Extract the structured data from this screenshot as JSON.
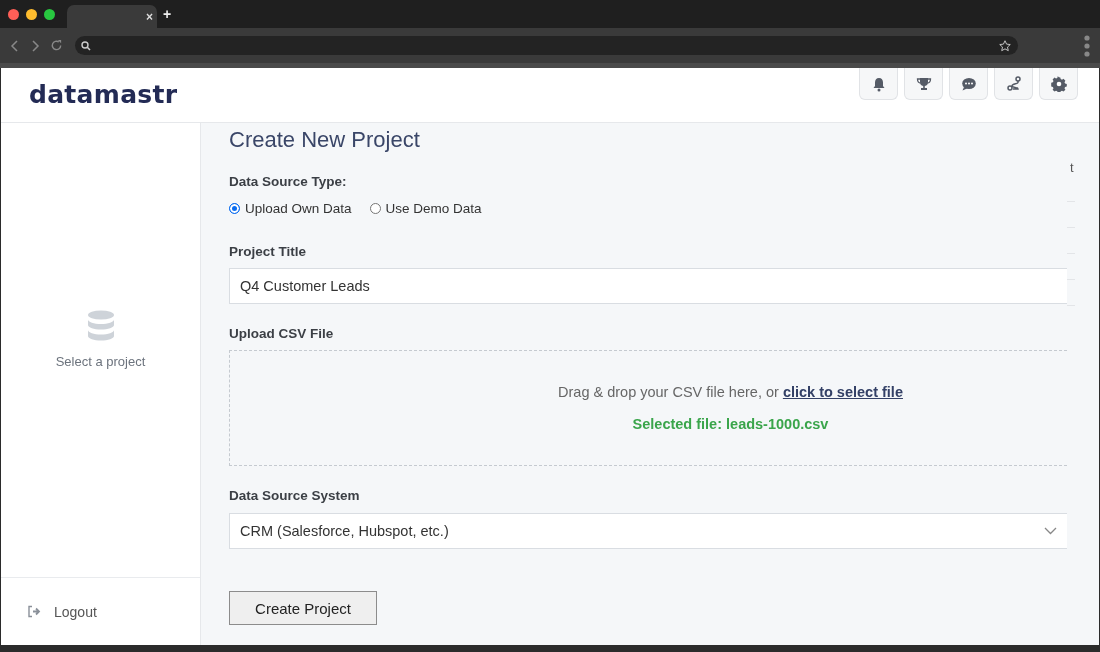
{
  "browser": {
    "tab_close": "×",
    "new_tab": "+"
  },
  "header": {
    "logo": "datamastr"
  },
  "sidebar": {
    "empty_text": "Select a project",
    "logout": "Logout"
  },
  "form": {
    "title": "Create New Project",
    "source_type_label": "Data Source Type:",
    "source_types": [
      {
        "label": "Upload Own Data",
        "selected": true
      },
      {
        "label": "Use Demo Data",
        "selected": false
      }
    ],
    "project_title_label": "Project Title",
    "project_title_value": "Q4 Customer Leads",
    "upload_label": "Upload CSV File",
    "drop_text": "Drag & drop your CSV file here, or ",
    "drop_link": "click to select file",
    "selected_file": "Selected file: leads-1000.csv",
    "system_label": "Data Source System",
    "system_value": "CRM (Salesforce, Hubspot, etc.)",
    "submit": "Create Project"
  },
  "side_panel": {
    "column_1": "t"
  }
}
